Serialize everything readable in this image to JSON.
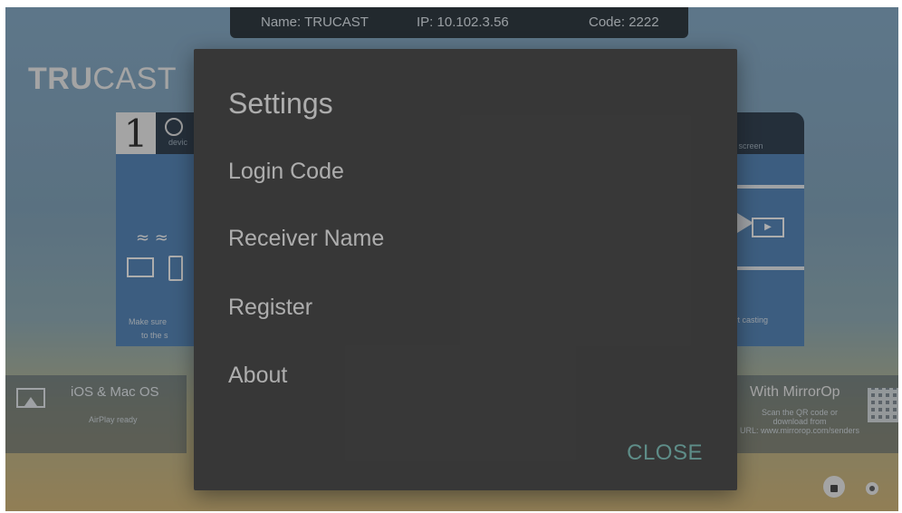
{
  "topbar": {
    "name": "Name: TRUCAST",
    "ip": "IP: 10.102.3.56",
    "code": "Code: 2222"
  },
  "brand": {
    "bold": "TRU",
    "rest": "CAST"
  },
  "card1": {
    "step": "1",
    "header_text": "devic",
    "hint_line1": "Make sure",
    "hint_line2": "to the s"
  },
  "card3": {
    "header_text": "e screen",
    "hint": "tart casting"
  },
  "left_strip": {
    "title": "iOS & Mac OS",
    "subtitle": "AirPlay ready"
  },
  "right_strip": {
    "title": "With MirrorOp",
    "line1": "Scan the QR code or",
    "line2": "download from",
    "line3": "URL: www.mirrorop.com/senders"
  },
  "dialog": {
    "title": "Settings",
    "items": [
      "Login Code",
      "Receiver Name",
      "Register",
      "About"
    ],
    "close_label": "CLOSE",
    "accent_color": "#80cbc4"
  },
  "icons": {
    "lock": "unlock-icon",
    "settings": "gear-icon"
  }
}
